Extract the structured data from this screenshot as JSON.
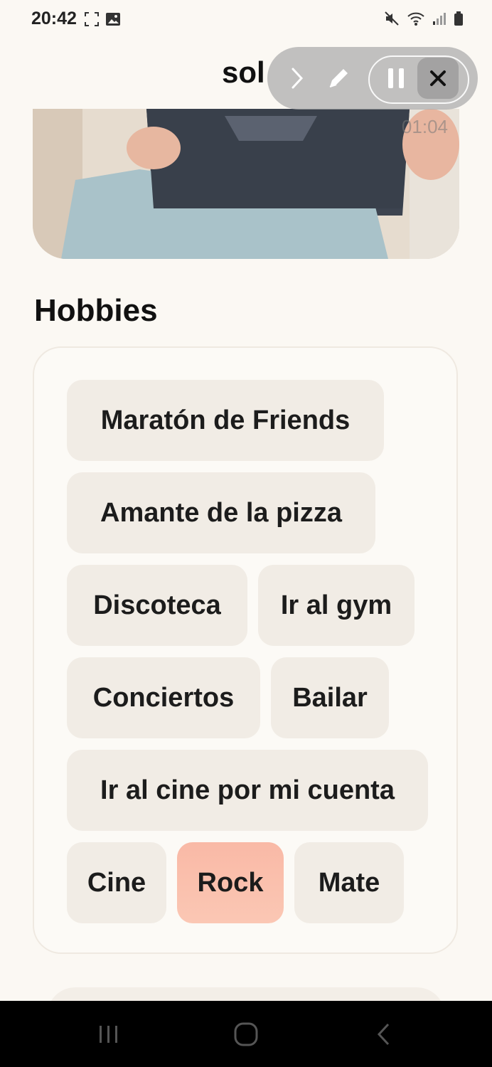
{
  "status_bar": {
    "time": "20:42",
    "left_icons": [
      "screen-record-icon",
      "gallery-icon"
    ],
    "right_icons": [
      "mute-icon",
      "wifi-icon",
      "signal-icon",
      "battery-icon"
    ]
  },
  "header": {
    "title": "sol"
  },
  "recording_toolbar": {
    "icons": [
      "chevron-right-icon",
      "pencil-icon",
      "pause-icon",
      "close-icon"
    ]
  },
  "photo": {
    "timer": "01:04"
  },
  "hobbies": {
    "title": "Hobbies",
    "chips": [
      {
        "label": "Maratón de Friends",
        "selected": false
      },
      {
        "label": "Amante de la pizza",
        "selected": false
      },
      {
        "label": "Discoteca",
        "selected": false
      },
      {
        "label": "Ir al gym",
        "selected": false
      },
      {
        "label": "Conciertos",
        "selected": false
      },
      {
        "label": "Bailar",
        "selected": false
      },
      {
        "label": "Ir al cine por mi cuenta",
        "selected": false
      },
      {
        "label": "Cine",
        "selected": false
      },
      {
        "label": "Rock",
        "selected": true
      },
      {
        "label": "Mate",
        "selected": false
      }
    ]
  },
  "colors": {
    "background": "#fbf8f3",
    "chip": "#f1ece5",
    "chip_selected": "#f9b9a6",
    "navbar": "#000000"
  },
  "nav_bar": {
    "icons": [
      "recent-apps-icon",
      "home-icon",
      "back-icon"
    ]
  }
}
